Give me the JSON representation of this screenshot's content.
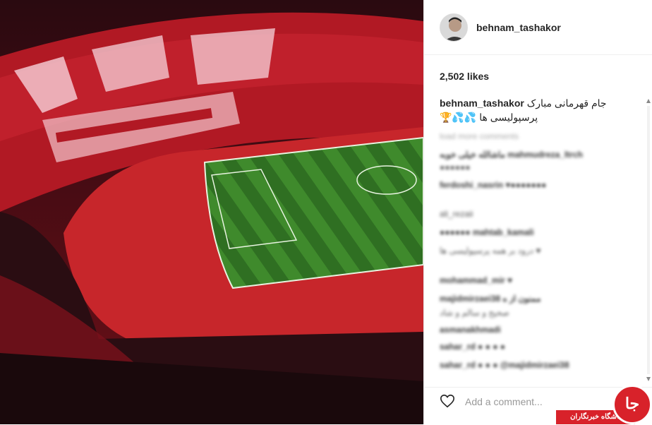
{
  "post": {
    "username": "behnam_tashakor",
    "likes": "2,502 likes",
    "caption_user": "behnam_tashakor",
    "caption_line1": "جام قهرمانی مبارک",
    "caption_line2": "🏆💦💦 پرسپولیسی ها"
  },
  "comments_blurred": [
    "load more comments",
    "ماشالله خیلی خوبه mahmudreza_ltrch",
    "●●●●●●",
    "ferdoshi_nasrin ♥●●●●●●●",
    "ali_rezaii",
    "●●●●●● mahtab_kamali",
    "درود بر همه پرسپولیسی ها ♥",
    "mohammad_mir ♥",
    "majidmirzaei38 ممنون از ه",
    "صحیح و سالم و شاد",
    "asmanakhmadi",
    "sahar_rd ● ● ● ●",
    "sahar_rd ● ● ● @majidmirzaei38"
  ],
  "footer": {
    "comment_placeholder": "Add a comment..."
  },
  "watermark": {
    "text": "باشگاه خبرنگاران",
    "glyph": "جا"
  },
  "icons": {
    "heart": "heart-icon",
    "avatar": "profile-photo"
  },
  "colors": {
    "accent": "#d8222a",
    "text": "#262626",
    "muted": "#999999"
  }
}
